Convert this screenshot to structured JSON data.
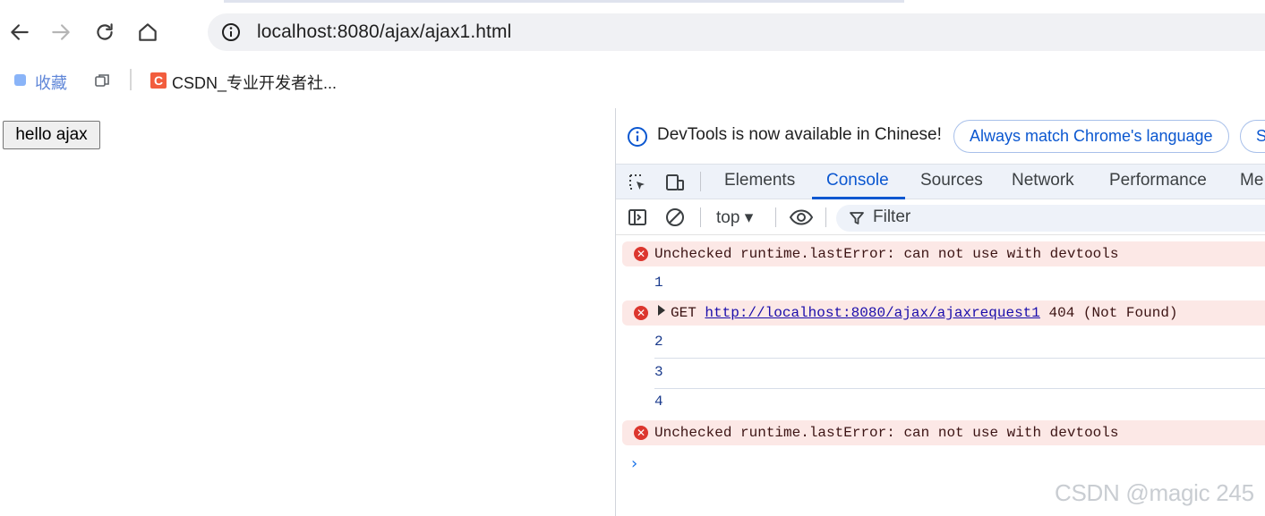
{
  "browser": {
    "url": "localhost:8080/ajax/ajax1.html",
    "bookmarks": [
      {
        "label": "收藏"
      },
      {
        "label": "CSDN_专业开发者社..."
      }
    ],
    "favicon_letter": "C"
  },
  "page": {
    "button_label": "hello ajax"
  },
  "devtools": {
    "infobar": {
      "message": "DevTools is now available in Chinese!",
      "button1": "Always match Chrome's language",
      "button2": "S"
    },
    "tabs": [
      "Elements",
      "Console",
      "Sources",
      "Network",
      "Performance",
      "Me"
    ],
    "active_tab": "Console",
    "console_bar": {
      "context": "top ▾",
      "filter_placeholder": "Filter"
    },
    "messages": [
      {
        "type": "error",
        "text": "Unchecked runtime.lastError: can not use with devtools"
      },
      {
        "type": "log",
        "text": "1"
      },
      {
        "type": "error",
        "method": "GET",
        "url": "http://localhost:8080/ajax/ajaxrequest1",
        "status": "404 (Not Found)"
      },
      {
        "type": "log",
        "text": "2"
      },
      {
        "type": "log",
        "text": "3"
      },
      {
        "type": "log",
        "text": "4"
      },
      {
        "type": "error",
        "text": "Unchecked runtime.lastError: can not use with devtools"
      }
    ],
    "prompt_symbol": "›"
  },
  "watermark": "CSDN @magic 245",
  "colors": {
    "accent": "#0b57d0",
    "error_bg": "#fce8e6",
    "error_icon": "#dc362e"
  }
}
